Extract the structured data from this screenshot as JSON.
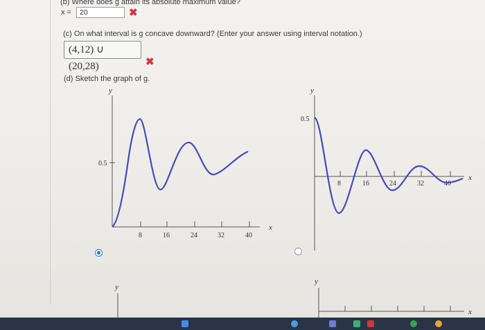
{
  "part_b": {
    "question": "(b) Where does g attain its absolute maximum value?",
    "var_label": "x =",
    "answer": "20",
    "mark": "✖"
  },
  "part_c": {
    "question": "(c) On what interval is g concave downward? (Enter your answer using interval notation.)",
    "answer": "(4,12) ∪ (20,28)",
    "mark": "✖"
  },
  "part_d": {
    "question": "(d) Sketch the graph of g."
  },
  "graph_left": {
    "y_label": "y",
    "x_label": "x",
    "y_tick": "0.5",
    "x_ticks": [
      "8",
      "16",
      "24",
      "32",
      "40"
    ],
    "selected": true
  },
  "graph_right": {
    "y_label": "y",
    "x_label": "x",
    "y_tick": "0.5",
    "x_ticks": [
      "8",
      "16",
      "24",
      "32",
      "40"
    ],
    "selected": false
  },
  "graph_bottom_left": {
    "y_label": "y"
  },
  "graph_bottom_right": {
    "y_label": "y",
    "x_label": "x"
  },
  "colors": {
    "curve": "#4a47b8",
    "error": "#d8334a",
    "radio_selected": "#2c6fd1"
  }
}
